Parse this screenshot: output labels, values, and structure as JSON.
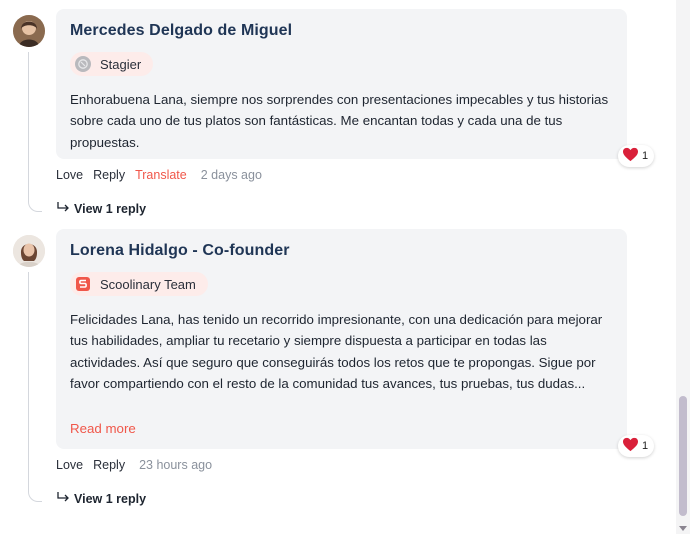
{
  "comments": [
    {
      "author": "Mercedes Delgado de Miguel",
      "badge": "Stagier",
      "badge_icon": "stagier-badge-icon",
      "text": "Enhorabuena Lana, siempre nos sorprendes con presentaciones impecables y tus historias sobre cada uno de tus platos son fantásticas. Me encantan todas y cada una de tus propuestas.",
      "reaction_count": "1",
      "actions": {
        "love": "Love",
        "reply": "Reply",
        "translate": "Translate",
        "time": "2 days ago"
      },
      "view_replies": "View 1 reply"
    },
    {
      "author": "Lorena Hidalgo - Co-founder",
      "badge": "Scoolinary Team",
      "badge_icon": "scoolinary-logo-icon",
      "text": "Felicidades Lana, has tenido un recorrido impresionante, con una dedicación para mejorar tus habilidades, ampliar tu recetario y siempre dispuesta a participar en todas las actividades. Así que seguro que conseguirás todos los retos que te propongas. Sigue por favor compartiendo con el resto de la comunidad tus avances, tus pruebas, tus dudas...",
      "read_more": "Read more",
      "reaction_count": "1",
      "actions": {
        "love": "Love",
        "reply": "Reply",
        "time": "23 hours ago"
      },
      "view_replies": "View 1 reply"
    }
  ],
  "colors": {
    "accent": "#f0574a",
    "bubble": "#f3f4f6",
    "author": "#1f3555",
    "heart": "#d9203a"
  }
}
